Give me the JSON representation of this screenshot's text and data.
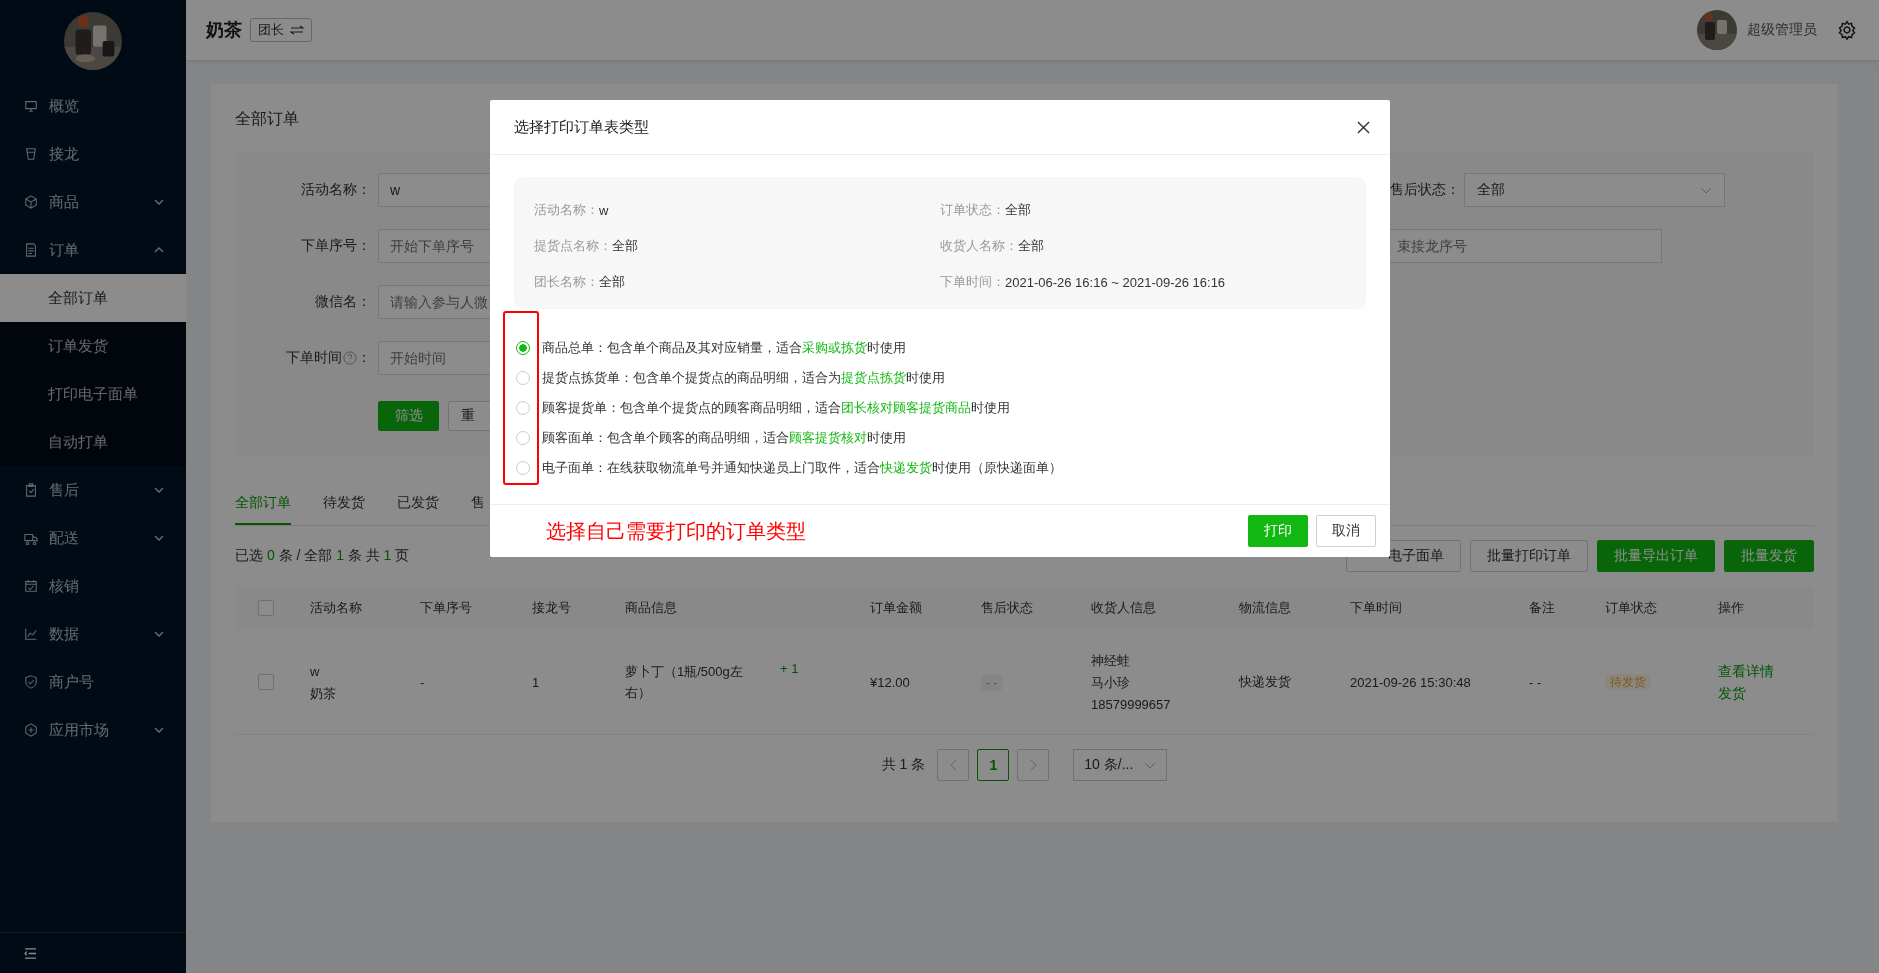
{
  "sidebar": {
    "items": [
      {
        "label": "概览",
        "kind": "link"
      },
      {
        "label": "接龙",
        "kind": "link"
      },
      {
        "label": "商品",
        "kind": "group",
        "expanded": false
      },
      {
        "label": "订单",
        "kind": "group",
        "expanded": true,
        "children": [
          {
            "label": "全部订单",
            "selected": true
          },
          {
            "label": "订单发货",
            "selected": false
          },
          {
            "label": "打印电子面单",
            "selected": false
          },
          {
            "label": "自动打单",
            "selected": false
          }
        ]
      },
      {
        "label": "售后",
        "kind": "group",
        "expanded": false
      },
      {
        "label": "配送",
        "kind": "group",
        "expanded": false
      },
      {
        "label": "核销",
        "kind": "link"
      },
      {
        "label": "数据",
        "kind": "group",
        "expanded": false
      },
      {
        "label": "商户号",
        "kind": "link"
      },
      {
        "label": "应用市场",
        "kind": "group",
        "expanded": false
      }
    ]
  },
  "header": {
    "shop": "奶茶",
    "role": "团长",
    "user": "超级管理员"
  },
  "page": {
    "title": "全部订单",
    "filters_left": [
      {
        "kind": "plain",
        "label": "活动名称：",
        "value": "w"
      },
      {
        "kind": "plain",
        "label": "下单序号：",
        "placeholder": "开始下单序号"
      },
      {
        "kind": "plain",
        "label": "微信名：",
        "placeholder": "请输入参与人微"
      },
      {
        "kind": "help",
        "label": "下单时间",
        "colon": "：",
        "placeholder": "开始时间"
      }
    ],
    "filters_right": [
      {
        "kind": "select",
        "label": "售后状态：",
        "value": "全部"
      },
      {
        "kind": "input",
        "placeholder": "束接龙序号"
      }
    ],
    "filter_buttons": [
      {
        "label": "筛选",
        "kind": "primary"
      },
      {
        "label": "重",
        "kind": "default"
      }
    ],
    "tabs": [
      {
        "label": "全部订单",
        "selected": true
      },
      {
        "label": "待发货",
        "selected": false
      },
      {
        "label": "已发货",
        "selected": false
      },
      {
        "label": "售",
        "selected": false
      }
    ],
    "summary": [
      {
        "text": "已选 ",
        "highlight": false
      },
      {
        "text": "0",
        "highlight": true
      },
      {
        "text": " 条 / 全部 ",
        "highlight": false
      },
      {
        "text": "1",
        "highlight": true
      },
      {
        "text": " 条 共 ",
        "highlight": false
      },
      {
        "text": "1",
        "highlight": true
      },
      {
        "text": " 页",
        "highlight": false
      }
    ],
    "actions": [
      {
        "label": "电子面单",
        "kind": "outline"
      },
      {
        "label": "批量打印订单",
        "kind": "outline"
      },
      {
        "label": "批量导出订单",
        "kind": "primary"
      },
      {
        "label": "批量发货",
        "kind": "primary"
      }
    ],
    "table": {
      "all_selected": false,
      "columns": [
        "活动名称",
        "下单序号",
        "接龙号",
        "商品信息",
        "订单金额",
        "售后状态",
        "收货人信息",
        "物流信息",
        "下单时间",
        "备注",
        "订单状态",
        "操作"
      ],
      "rows": [
        {
          "selected": false,
          "activity": [
            "w",
            "奶茶"
          ],
          "serial": "-",
          "chain_no": "1",
          "product": "萝卜丁（1瓶/500g左右）",
          "quantity": "+ 1",
          "amount": "¥12.00",
          "after_sale": "- -",
          "receiver": [
            "神经蛙",
            "马小珍",
            "18579999657"
          ],
          "logistics": "快递发货",
          "time": "2021-09-26 15:30:48",
          "note": "- -",
          "status": "待发货",
          "actions": [
            "查看详情",
            "发货"
          ]
        }
      ]
    },
    "pagination": {
      "total": "共 1 条",
      "pages": [
        {
          "label": "1",
          "selected": true
        }
      ],
      "page_size": "10 条/..."
    }
  },
  "modal": {
    "title": "选择打印订单表类型",
    "info": [
      {
        "label": "活动名称：",
        "value": "w"
      },
      {
        "label": "订单状态：",
        "value": "全部"
      },
      {
        "label": "提货点名称：",
        "value": "全部"
      },
      {
        "label": "收货人名称：",
        "value": "全部"
      },
      {
        "label": "团长名称：",
        "value": "全部"
      },
      {
        "label": "下单时间：",
        "value": "2021-06-26 16:16 ~ 2021-09-26 16:16"
      }
    ],
    "options": [
      {
        "prefix": "商品总单：包含单个商品及其对应销量，适合",
        "highlight": "采购或拣货",
        "suffix": "时使用",
        "selected": true
      },
      {
        "prefix": "提货点拣货单：包含单个提货点的商品明细，适合为",
        "highlight": "提货点拣货",
        "suffix": "时使用",
        "selected": false
      },
      {
        "prefix": "顾客提货单：包含单个提货点的顾客商品明细，适合",
        "highlight": "团长核对顾客提货商品",
        "suffix": "时使用",
        "selected": false
      },
      {
        "prefix": "顾客面单：包含单个顾客的商品明细，适合",
        "highlight": "顾客提货核对",
        "suffix": "时使用",
        "selected": false
      },
      {
        "prefix": "电子面单：在线获取物流单号并通知快递员上门取件，适合",
        "highlight": "快递发货",
        "suffix": "时使用（原快递面单）",
        "selected": false
      }
    ],
    "annotation": "选择自己需要打印的订单类型",
    "buttons": [
      {
        "label": "打印",
        "kind": "primary"
      },
      {
        "label": "取消",
        "kind": "default"
      }
    ]
  }
}
